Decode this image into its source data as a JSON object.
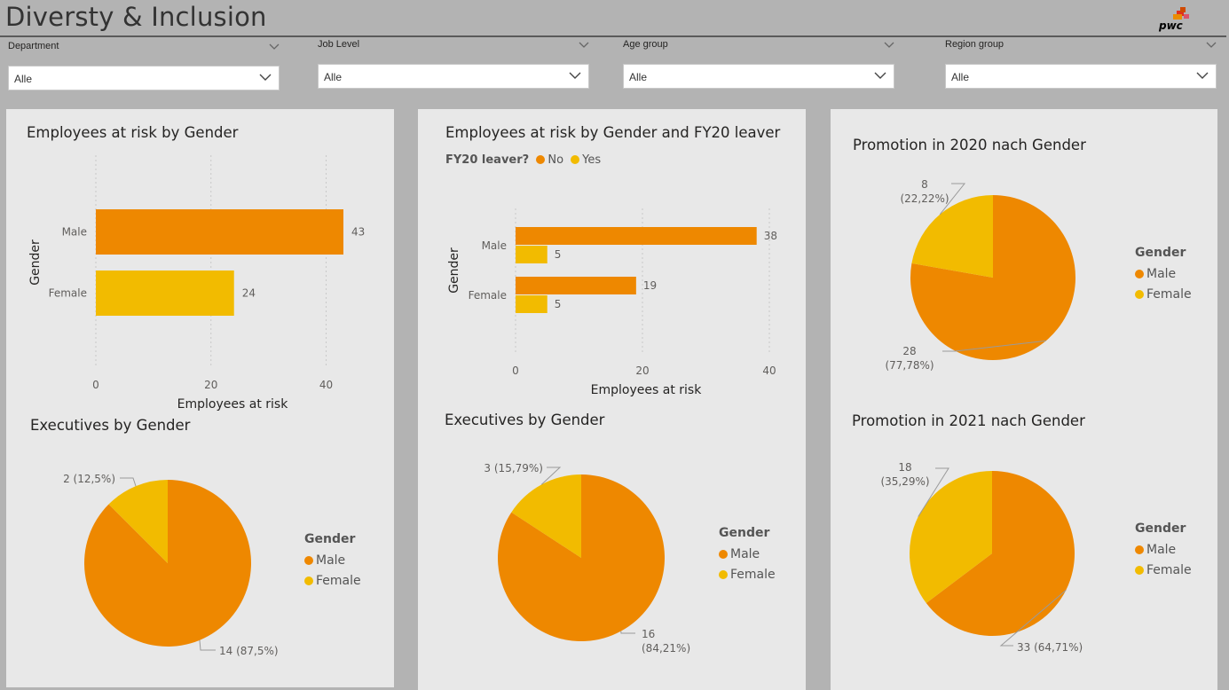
{
  "report": {
    "title": "Diversty & Inclusion",
    "logo_text": "pwc"
  },
  "colors": {
    "male": "#ee8800",
    "female": "#f2bb00",
    "panel": "#e8e8e8",
    "canvas": "#b3b3b3"
  },
  "icons": {
    "slicer_dropdown": "chevron-down-icon",
    "logo": "pwc-logo-icon"
  },
  "slicers": [
    {
      "label": "Department",
      "value": "Alle"
    },
    {
      "label": "Job Level",
      "value": "Alle"
    },
    {
      "label": "Age group",
      "value": "Alle"
    },
    {
      "label": "Region group",
      "value": "Alle"
    }
  ],
  "visuals": {
    "risk_gender": {
      "title": "Employees at risk by Gender"
    },
    "risk_leaver": {
      "title": "Employees at risk by Gender and FY20 leaver",
      "legend_title": "FY20 leaver?"
    },
    "exec_p1": {
      "title": "Executives by Gender"
    },
    "exec_p2": {
      "title": "Executives by Gender"
    },
    "promo_2020": {
      "title": "Promotion in 2020 nach Gender"
    },
    "promo_2021": {
      "title": "Promotion in 2021 nach Gender"
    }
  },
  "chart_data": [
    {
      "id": "risk_gender",
      "type": "bar",
      "orientation": "horizontal",
      "title": "Employees at risk by Gender",
      "categories": [
        "Male",
        "Female"
      ],
      "values": [
        43,
        24
      ],
      "value_labels": [
        "43",
        "24"
      ],
      "bar_colors": [
        "#ee8800",
        "#f2bb00"
      ],
      "xlabel": "Employees at risk",
      "ylabel": "Gender",
      "xlim": [
        0,
        43
      ],
      "xticks": [
        0,
        20,
        40
      ],
      "xtick_labels": [
        "0",
        "20",
        "40"
      ],
      "grid": true
    },
    {
      "id": "risk_leaver",
      "type": "bar",
      "orientation": "horizontal",
      "title": "Employees at risk by Gender and FY20 leaver",
      "categories": [
        "Male",
        "Female"
      ],
      "legend_title": "FY20 leaver?",
      "series": [
        {
          "name": "No",
          "color": "#ee8800",
          "values": [
            38,
            19
          ],
          "value_labels": [
            "38",
            "19"
          ]
        },
        {
          "name": "Yes",
          "color": "#f2bb00",
          "values": [
            5,
            5
          ],
          "value_labels": [
            "5",
            "5"
          ]
        }
      ],
      "xlabel": "Employees at risk",
      "ylabel": "Gender",
      "xlim": [
        0,
        40
      ],
      "xticks": [
        0,
        20,
        40
      ],
      "xtick_labels": [
        "0",
        "20",
        "40"
      ],
      "legend_position": "top-left",
      "grid": true
    },
    {
      "id": "exec_p1",
      "type": "pie",
      "title": "Executives by Gender",
      "legend_title": "Gender",
      "legend_position": "right",
      "slices": [
        {
          "name": "Male",
          "value": 14,
          "color": "#ee8800",
          "label": "14 (87,5%)"
        },
        {
          "name": "Female",
          "value": 2,
          "color": "#f2bb00",
          "label": "2 (12,5%)"
        }
      ]
    },
    {
      "id": "exec_p2",
      "type": "pie",
      "title": "Executives by Gender",
      "legend_title": "Gender",
      "legend_position": "right",
      "slices": [
        {
          "name": "Male",
          "value": 16,
          "color": "#ee8800",
          "label": "16 (84,21%)"
        },
        {
          "name": "Female",
          "value": 3,
          "color": "#f2bb00",
          "label": "3 (15,79%)"
        }
      ]
    },
    {
      "id": "promo_2020",
      "type": "pie",
      "title": "Promotion in 2020 nach Gender",
      "legend_title": "Gender",
      "legend_position": "right",
      "slices": [
        {
          "name": "Male",
          "value": 28,
          "color": "#ee8800",
          "label": "28 (77,78%)"
        },
        {
          "name": "Female",
          "value": 8,
          "color": "#f2bb00",
          "label": "8 (22,22%)"
        }
      ]
    },
    {
      "id": "promo_2021",
      "type": "pie",
      "title": "Promotion in 2021 nach Gender",
      "legend_title": "Gender",
      "legend_position": "right",
      "slices": [
        {
          "name": "Male",
          "value": 33,
          "color": "#ee8800",
          "label": "33 (64,71%)"
        },
        {
          "name": "Female",
          "value": 18,
          "color": "#f2bb00",
          "label": "18 (35,29%)"
        }
      ]
    }
  ]
}
